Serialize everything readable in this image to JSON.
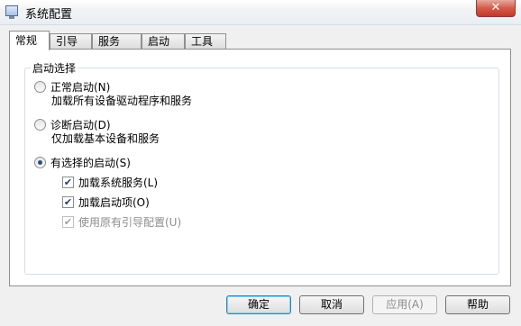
{
  "window": {
    "title": "系统配置",
    "close_glyph": "✕"
  },
  "tabs": [
    {
      "label": "常规",
      "active": true
    },
    {
      "label": "引导",
      "active": false
    },
    {
      "label": "服务",
      "active": false
    },
    {
      "label": "启动",
      "active": false
    },
    {
      "label": "工具",
      "active": false
    }
  ],
  "startup_selection": {
    "group_title": "启动选择",
    "options": [
      {
        "label": "正常启动(N)",
        "description": "加载所有设备驱动程序和服务",
        "selected": false
      },
      {
        "label": "诊断启动(D)",
        "description": "仅加载基本设备和服务",
        "selected": false
      },
      {
        "label": "有选择的启动(S)",
        "selected": true
      }
    ],
    "selective_items": [
      {
        "label": "加载系统服务(L)",
        "checked": true,
        "enabled": true
      },
      {
        "label": "加载启动项(O)",
        "checked": true,
        "enabled": true
      },
      {
        "label": "使用原有引导配置(U)",
        "checked": true,
        "enabled": false
      }
    ]
  },
  "buttons": {
    "ok": "确定",
    "cancel": "取消",
    "apply": "应用(A)",
    "help": "帮助"
  },
  "check_glyph": "✔"
}
